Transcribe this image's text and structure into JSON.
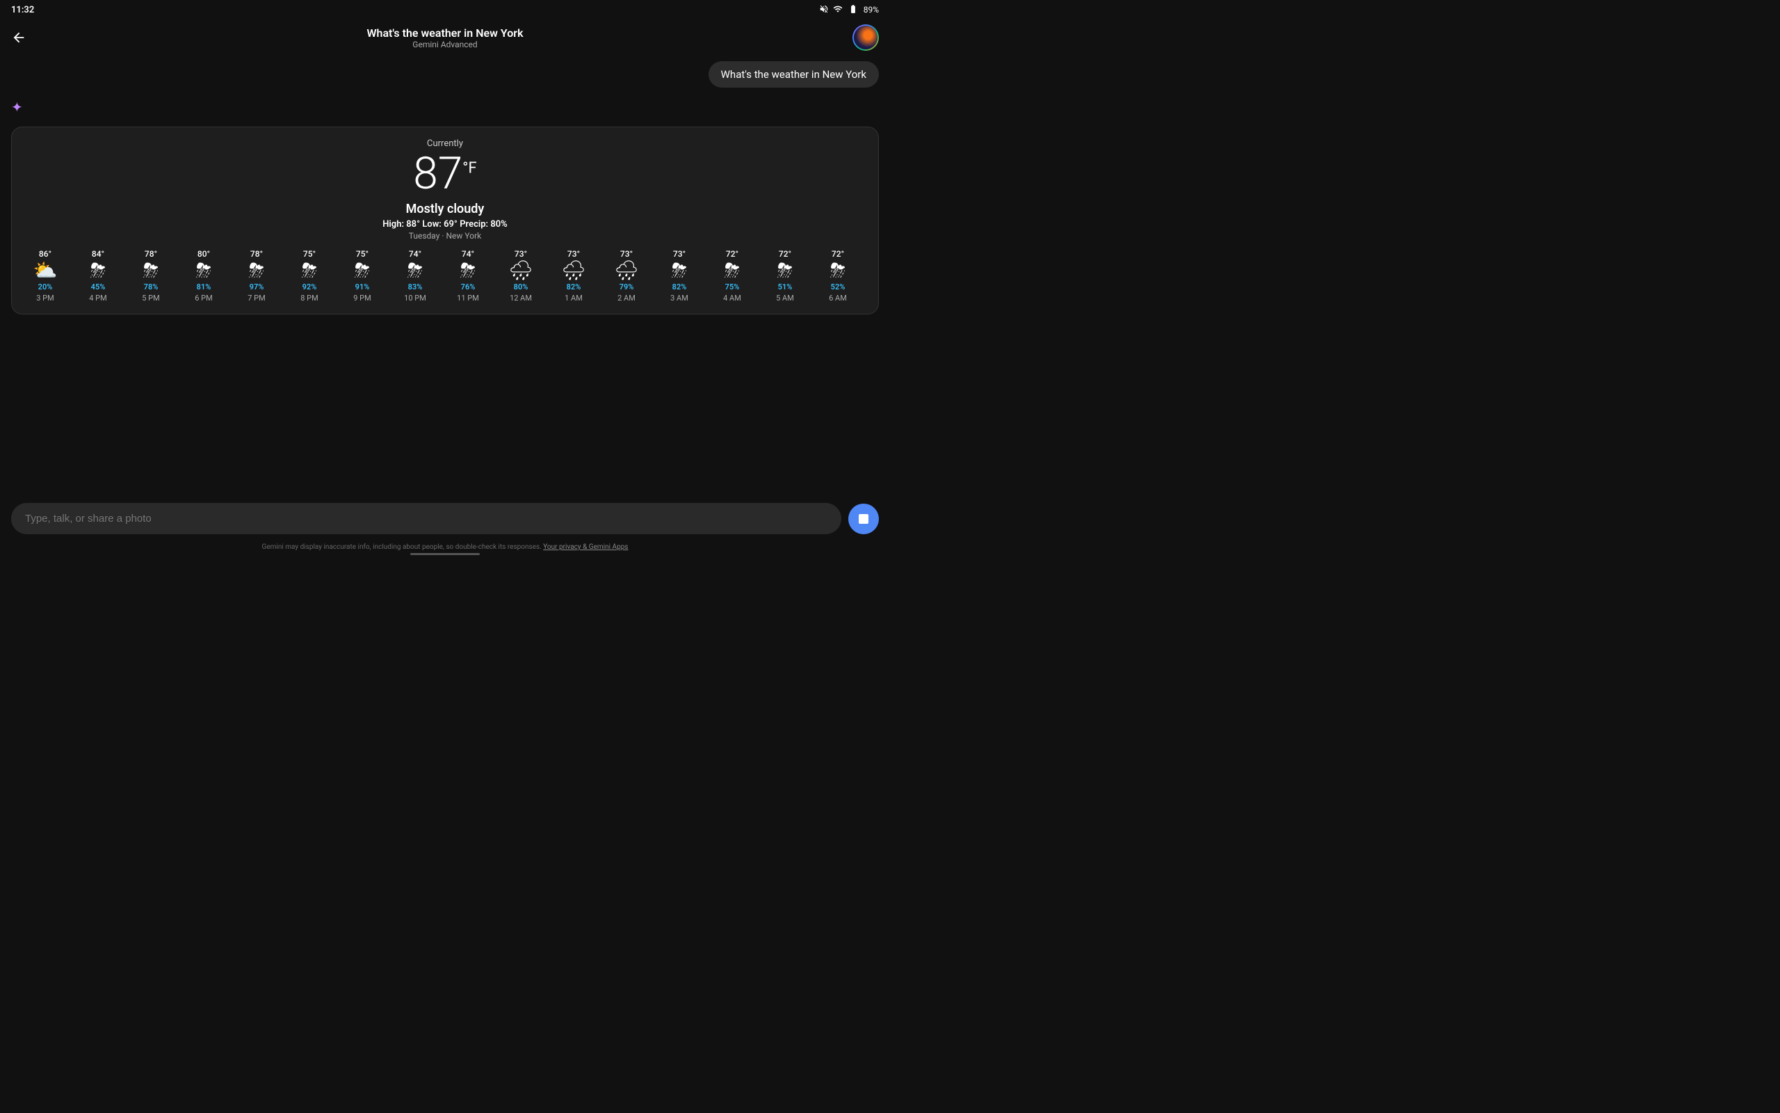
{
  "status": {
    "time": "11:32",
    "battery": "89%"
  },
  "header": {
    "title": "What's the weather in New York",
    "subtitle": "Gemini Advanced",
    "back_label": "←"
  },
  "user_message": "What's the weather in New York",
  "weather": {
    "currently_label": "Currently",
    "temperature": "87",
    "unit": "°F",
    "description": "Mostly cloudy",
    "high": "88°",
    "low": "69°",
    "precip": "80%",
    "location": "Tuesday · New York",
    "details_label": "High: 88° Low: 69°  Precip: 80%"
  },
  "hourly": [
    {
      "temp": "86°",
      "precip": "20%",
      "label": "3 PM",
      "icon": "⛅"
    },
    {
      "temp": "84°",
      "precip": "45%",
      "label": "4 PM",
      "icon": "⛈"
    },
    {
      "temp": "78°",
      "precip": "78%",
      "label": "5 PM",
      "icon": "⛈"
    },
    {
      "temp": "80°",
      "precip": "81%",
      "label": "6 PM",
      "icon": "⛈"
    },
    {
      "temp": "78°",
      "precip": "97%",
      "label": "7 PM",
      "icon": "⛈"
    },
    {
      "temp": "75°",
      "precip": "92%",
      "label": "8 PM",
      "icon": "⛈"
    },
    {
      "temp": "75°",
      "precip": "91%",
      "label": "9 PM",
      "icon": "⛈"
    },
    {
      "temp": "74°",
      "precip": "83%",
      "label": "10 PM",
      "icon": "⛈"
    },
    {
      "temp": "74°",
      "precip": "76%",
      "label": "11 PM",
      "icon": "⛈"
    },
    {
      "temp": "73°",
      "precip": "80%",
      "label": "12 AM",
      "icon": "🌧"
    },
    {
      "temp": "73°",
      "precip": "82%",
      "label": "1 AM",
      "icon": "🌧"
    },
    {
      "temp": "73°",
      "precip": "79%",
      "label": "2 AM",
      "icon": "🌧"
    },
    {
      "temp": "73°",
      "precip": "82%",
      "label": "3 AM",
      "icon": "⛈"
    },
    {
      "temp": "72°",
      "precip": "75%",
      "label": "4 AM",
      "icon": "⛈"
    },
    {
      "temp": "72°",
      "precip": "51%",
      "label": "5 AM",
      "icon": "⛈"
    },
    {
      "temp": "72°",
      "precip": "52%",
      "label": "6 AM",
      "icon": "⛈"
    }
  ],
  "input": {
    "placeholder": "Type, talk, or share a photo"
  },
  "footer": {
    "disclaimer": "Gemini may display inaccurate info, including about people, so double-check its responses.",
    "link_text": "Your privacy & Gemini Apps"
  }
}
